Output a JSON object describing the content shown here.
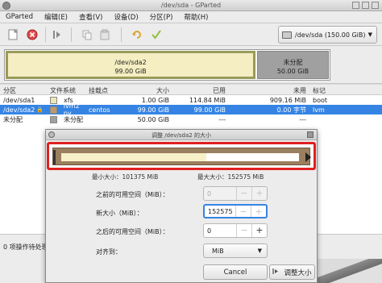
{
  "window": {
    "title": "/dev/sda - GParted"
  },
  "menu": [
    "GParted",
    "编辑(E)",
    "查看(V)",
    "设备(D)",
    "分区(P)",
    "帮助(H)"
  ],
  "toolbar": {
    "device_label": "/dev/sda (150.00 GiB)"
  },
  "map": {
    "seg1_name": "/dev/sda2",
    "seg1_size": "99.00 GiB",
    "seg2_name": "未分配",
    "seg2_size": "50.00 GiB"
  },
  "table": {
    "headers": [
      "分区",
      "文件系统",
      "挂载点",
      "大小",
      "已用",
      "未用",
      "标记"
    ],
    "rows": [
      {
        "part": "/dev/sda1",
        "fs": "xfs",
        "mount": "",
        "size": "1.00 GiB",
        "used": "114.84 MiB",
        "unused": "909.16 MiB",
        "flags": "boot"
      },
      {
        "part": "/dev/sda2",
        "fs": "lvm2 pv",
        "mount": "centos",
        "size": "99.00 GiB",
        "used": "99.00 GiB",
        "unused": "0.00 字节",
        "flags": "lvm"
      },
      {
        "part": "未分配",
        "fs": "未分配",
        "mount": "",
        "size": "50.00 GiB",
        "used": "---",
        "unused": "---",
        "flags": ""
      }
    ]
  },
  "status": {
    "text": "0 项操作待处理"
  },
  "dialog": {
    "title": "调整 /dev/sda2 的大小",
    "min_size": "最小大小：101375 MiB",
    "max_size": "最大大小：152575 MiB",
    "free_before_label": "之前的可用空间（MiB）：",
    "free_before_value": "0",
    "new_size_label": "新大小（MiB）：",
    "new_size_value": "152575",
    "free_after_label": "之后的可用空间（MiB）：",
    "free_after_value": "0",
    "align_label": "对齐到：",
    "align_value": "MiB",
    "cancel_label": "Cancel",
    "resize_label": "调整大小"
  },
  "colors": {
    "selection": "#3584e4",
    "highlight_border": "#e02020",
    "xfs": "#ece7b5",
    "lvm": "#bc9a6a",
    "unallocated": "#a0a0a0"
  }
}
